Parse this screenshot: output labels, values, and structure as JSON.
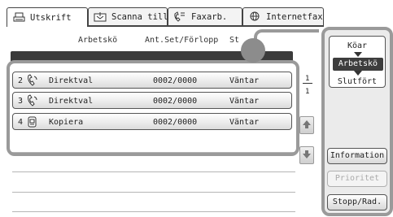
{
  "tabs": [
    {
      "label": "Utskrift",
      "icon": "printer-icon",
      "active": true
    },
    {
      "label": "Scanna till",
      "icon": "scan-icon",
      "active": false
    },
    {
      "label": "Faxarb.",
      "icon": "fax-icon",
      "active": false
    },
    {
      "label": "Internetfax",
      "icon": "internet-fax-icon",
      "active": false
    }
  ],
  "headers": {
    "job": "Arbetskö",
    "sets": "Ant.Set/Förlopp",
    "status": "St"
  },
  "jobs": [
    {
      "num": "2",
      "icon": "phone-icon",
      "name": "Direktval",
      "count": "0002/0000",
      "status": "Väntar"
    },
    {
      "num": "3",
      "icon": "phone-icon",
      "name": "Direktval",
      "count": "0002/0000",
      "status": "Väntar"
    },
    {
      "num": "4",
      "icon": "copy-icon",
      "name": "Kopiera",
      "count": "0002/0000",
      "status": "Väntar"
    }
  ],
  "pager": {
    "current": "1",
    "total": "1"
  },
  "mode": {
    "items": [
      "Köar",
      "Arbetskö",
      "Slutfört"
    ],
    "selected": "Arbetskö"
  },
  "buttons": {
    "information": "Information",
    "priority": "Prioritet",
    "stop_delete": "Stopp/Rad."
  },
  "colors": {
    "frame": "#9a9a9a",
    "selected": "#3d3d3d"
  }
}
